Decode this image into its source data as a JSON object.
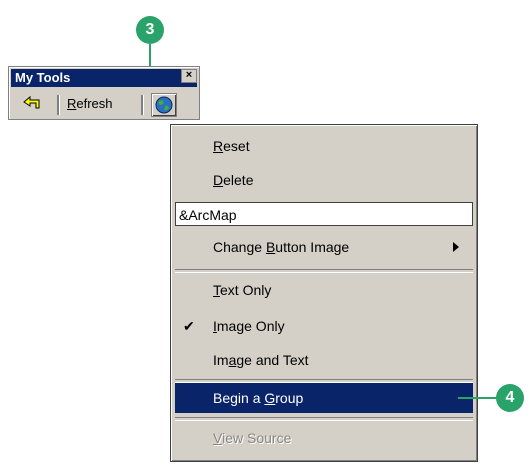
{
  "callouts": {
    "three": "3",
    "four": "4"
  },
  "toolbar": {
    "title": "My Tools",
    "close": "×",
    "refresh_prefix": "",
    "refresh_u": "R",
    "refresh_rest": "efresh"
  },
  "menu": {
    "reset": {
      "u": "R",
      "rest": "eset"
    },
    "delete": {
      "u": "D",
      "rest": "elete"
    },
    "name_value": "&ArcMap",
    "change_image": {
      "pre": "Change ",
      "u": "B",
      "rest": "utton Image"
    },
    "text_only": {
      "u": "T",
      "rest": "ext Only"
    },
    "image_only": {
      "pre": "",
      "u": "I",
      "rest": "mage Only",
      "checked": true,
      "check": "✔"
    },
    "image_text": {
      "pre": "Im",
      "u": "a",
      "rest": "ge and Text"
    },
    "begin_group": {
      "pre": "Begin a ",
      "u": "G",
      "rest": "roup"
    },
    "view_source": {
      "u": "V",
      "rest": "iew Source"
    }
  },
  "colors": {
    "callout": "#2aa36a",
    "highlight": "#0a246a",
    "face": "#d4d0c8"
  }
}
